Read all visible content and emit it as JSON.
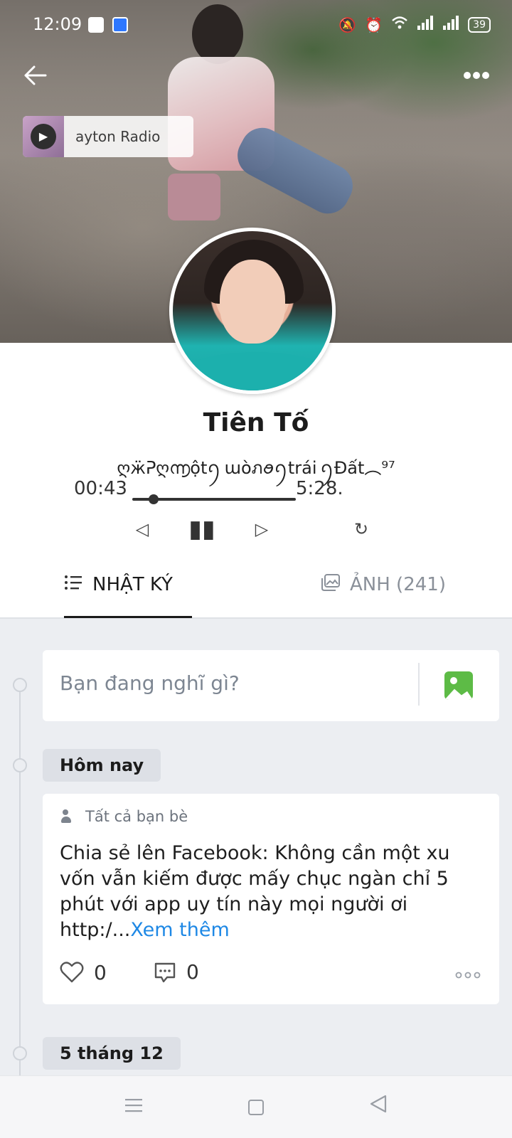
{
  "status_bar": {
    "time": "12:09",
    "battery": "39",
    "icons": [
      "sim-card-icon",
      "hotspot-icon",
      "mute-icon",
      "alarm-icon",
      "wifi-icon",
      "signal-icon",
      "signal-icon"
    ]
  },
  "header": {
    "back_icon": "back-arrow-icon",
    "more_icon": "more-dots-icon"
  },
  "radio": {
    "label": "ayton Radio",
    "play_icon": "play-icon"
  },
  "profile": {
    "name": "Tiên Tố",
    "status": "ღӝᕈღ൬ộtꪆ ɯòภꪮꪆtrái ꪆĐất︵⁹⁷",
    "player": {
      "elapsed": "00:43",
      "total": "5:28.",
      "progress": 0.13
    }
  },
  "tabs": [
    {
      "label": "NHẬT KÝ",
      "icon": "list-icon",
      "active": true
    },
    {
      "label": "ẢNH (241)",
      "icon": "photos-icon",
      "active": false
    }
  ],
  "compose": {
    "placeholder": "Bạn đang nghĩ gì?",
    "icon": "photo-icon"
  },
  "feed": {
    "groups": [
      {
        "date": "Hôm nay",
        "post": {
          "privacy": "Tất cả bạn bè",
          "text": "Chia sẻ lên Facebook: Không cần một xu vốn vẫn kiếm được mấy chục ngàn chỉ 5 phút với app uy tín này mọi người ơi http:/...",
          "more_label": "Xem thêm",
          "likes": "0",
          "comments": "0"
        }
      },
      {
        "date": "5 tháng 12"
      }
    ]
  },
  "colors": {
    "accent": "#1e88e5",
    "photo_icon": "#5dbb46",
    "page_bg": "#eceef2"
  }
}
